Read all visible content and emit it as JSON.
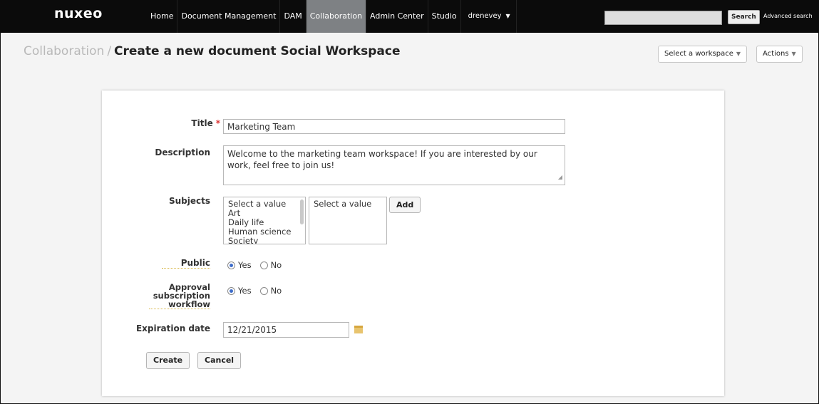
{
  "topbar": {
    "logo": "nuxeo",
    "nav": [
      {
        "label": "Home"
      },
      {
        "label": "Document Management"
      },
      {
        "label": "DAM"
      },
      {
        "label": "Collaboration",
        "active": true
      },
      {
        "label": "Admin Center"
      },
      {
        "label": "Studio"
      },
      {
        "label": "drenevey"
      }
    ],
    "search_button": "Search",
    "advanced_search": "Advanced search"
  },
  "header": {
    "breadcrumb_root": "Collaboration",
    "breadcrumb_sep": "/",
    "title": "Create a new document Social Workspace",
    "workspace_select": "Select a workspace",
    "actions": "Actions"
  },
  "form": {
    "title_label": "Title",
    "title_required": "*",
    "title_value": "Marketing Team",
    "description_label": "Description",
    "description_value": "Welcome to the marketing team workspace! If you are interested by our work, feel free to join us!",
    "subjects_label": "Subjects",
    "subjects_options": [
      "Select a value",
      "Art",
      "Daily life",
      "Human science",
      "Society"
    ],
    "subjects_selected": [
      "Select a value"
    ],
    "add_button": "Add",
    "public_label": "Public",
    "approval_label_1": "Approval",
    "approval_label_2": "subscription",
    "approval_label_3": "workflow",
    "yes": "Yes",
    "no": "No",
    "public_value": "Yes",
    "approval_value": "Yes",
    "expiration_label": "Expiration date",
    "expiration_value": "12/21/2015",
    "create_button": "Create",
    "cancel_button": "Cancel"
  },
  "colors": {
    "topbar_bg": "#0b0b0b",
    "active_tab": "#7e8184",
    "radio_accent": "#3d6cc9",
    "required": "#d33333"
  }
}
